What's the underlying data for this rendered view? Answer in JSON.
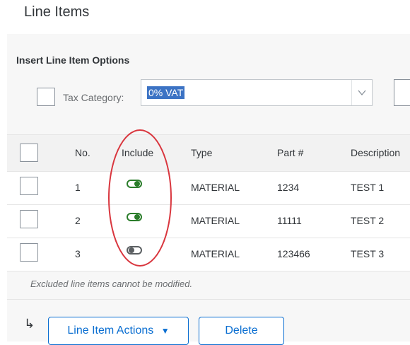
{
  "section": {
    "title": "Line Items"
  },
  "options": {
    "title": "Insert Line Item Options",
    "tax_label": "Tax Category:",
    "tax_value": "0% VAT"
  },
  "table": {
    "headers": {
      "no": "No.",
      "include": "Include",
      "type": "Type",
      "part": "Part #",
      "description": "Description"
    },
    "rows": [
      {
        "no": "1",
        "include": true,
        "type": "MATERIAL",
        "part": "1234",
        "description": "TEST 1"
      },
      {
        "no": "2",
        "include": true,
        "type": "MATERIAL",
        "part": "11111",
        "description": "TEST 2"
      },
      {
        "no": "3",
        "include": false,
        "type": "MATERIAL",
        "part": "123466",
        "description": "TEST 3"
      }
    ]
  },
  "footer": {
    "note": "Excluded line items cannot be modified.",
    "arrow_icon": "↳",
    "line_item_actions": "Line Item Actions",
    "dropdown_caret": "▼",
    "delete": "Delete"
  },
  "colors": {
    "accent": "#0a6ed1",
    "toggle_on": "#2b7d2b",
    "annotation": "#d9363e",
    "selection": "#3c73c4"
  },
  "icons": {
    "chevron": "chevron-down-icon",
    "arrow": "return-arrow-icon"
  }
}
